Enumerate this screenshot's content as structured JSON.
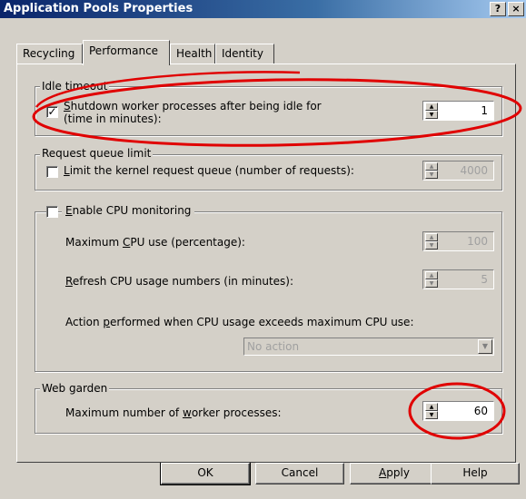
{
  "window": {
    "title": "Application Pools Properties",
    "help_button": "?",
    "close_button": "×"
  },
  "tabs": [
    {
      "label": "Recycling",
      "active": false
    },
    {
      "label": "Performance",
      "active": true
    },
    {
      "label": "Health",
      "active": false
    },
    {
      "label": "Identity",
      "active": false
    }
  ],
  "idle_timeout": {
    "group_label": "Idle timeout",
    "checkbox_checked": true,
    "label_line1_pre": "",
    "label_line1_accel": "S",
    "label_line1_post": "hutdown worker processes after being idle for",
    "label_line2": "(time in minutes):",
    "value": "1"
  },
  "request_queue": {
    "group_label": "Request queue limit",
    "checkbox_checked": false,
    "label_accel": "L",
    "label_post": "imit the kernel request queue (number of requests):",
    "value": "4000"
  },
  "cpu": {
    "checkbox_checked": false,
    "label_accel": "E",
    "label_post": "nable CPU monitoring",
    "max_cpu_pre": "Maximum ",
    "max_cpu_accel": "C",
    "max_cpu_post": "PU use (percentage):",
    "max_cpu_value": "100",
    "refresh_pre": "",
    "refresh_accel": "R",
    "refresh_post": "efresh CPU usage numbers (in minutes):",
    "refresh_value": "5",
    "action_pre": "Action ",
    "action_accel": "p",
    "action_post": "erformed when CPU usage exceeds maximum CPU use:",
    "action_selected": "No action"
  },
  "web_garden": {
    "group_label": "Web garden",
    "label_pre": "Maximum number of ",
    "label_accel": "w",
    "label_post": "orker processes:",
    "value": "60"
  },
  "buttons": {
    "ok": "OK",
    "cancel": "Cancel",
    "apply_accel": "A",
    "apply_post": "pply",
    "help": "Help"
  },
  "colors": {
    "dialog_bg": "#d4d0c8",
    "title_gradient_start": "#0a246a",
    "annotation_red": "#e00000"
  }
}
